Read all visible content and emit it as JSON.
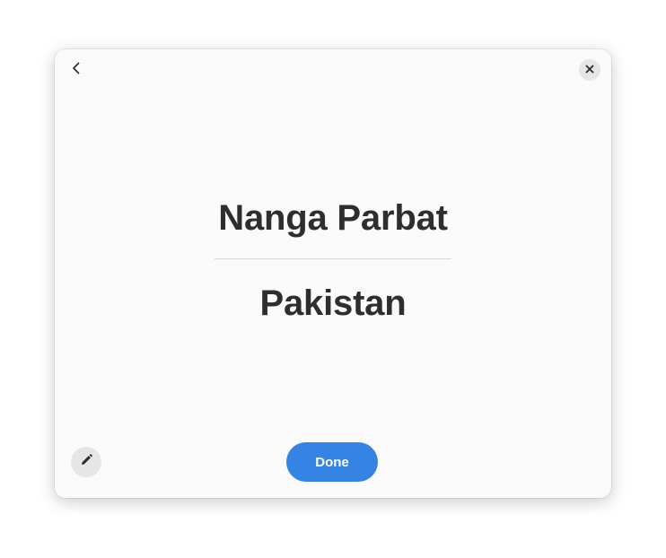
{
  "card": {
    "front": "Nanga Parbat",
    "back": "Pakistan"
  },
  "actions": {
    "done_label": "Done"
  },
  "icons": {
    "back": "go-previous-icon",
    "close": "window-close-icon",
    "edit": "pencil-icon"
  },
  "colors": {
    "accent": "#3584e4",
    "text": "#2e2e2e",
    "window_bg": "#fafafa"
  }
}
